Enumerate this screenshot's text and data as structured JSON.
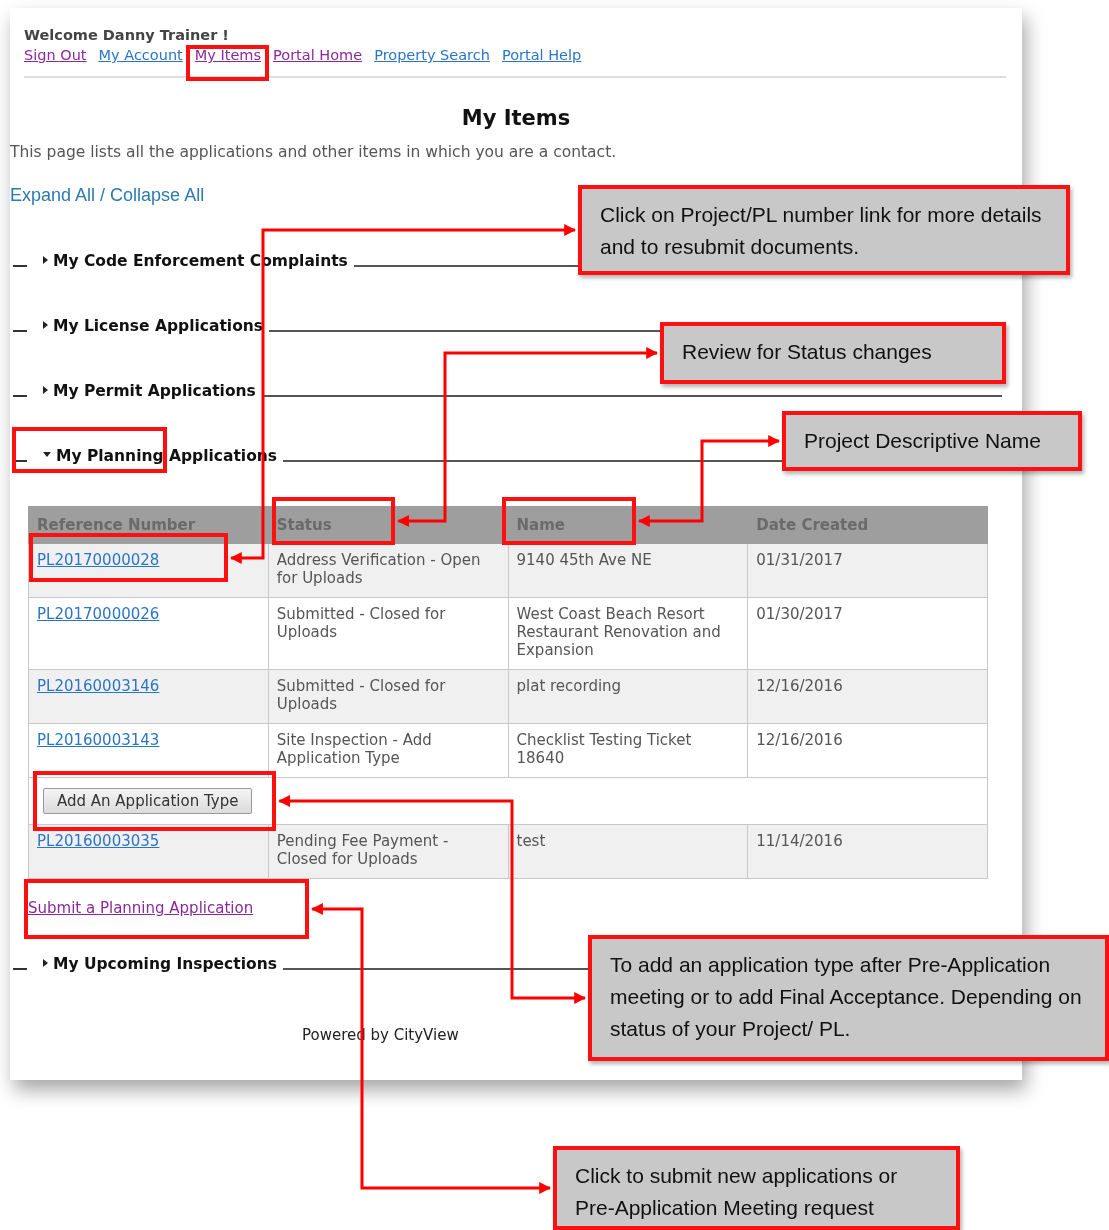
{
  "header": {
    "welcome": "Welcome Danny Trainer !",
    "links": [
      {
        "label": "Sign Out",
        "visited": true
      },
      {
        "label": "My Account",
        "visited": false
      },
      {
        "label": "My Items",
        "visited": true
      },
      {
        "label": "Portal Home",
        "visited": true
      },
      {
        "label": "Property Search",
        "visited": false
      },
      {
        "label": "Portal Help",
        "visited": false
      }
    ]
  },
  "title": "My Items",
  "description": "This page lists all the applications and other items in which you are a contact.",
  "toggle_links": {
    "expand": "Expand All",
    "separator": "/",
    "collapse": "Collapse All"
  },
  "sections": [
    {
      "title": "My Code Enforcement Complaints",
      "expanded": false
    },
    {
      "title": "My License Applications",
      "expanded": false
    },
    {
      "title": "My Permit Applications",
      "expanded": false
    },
    {
      "title": "My Planning Applications",
      "expanded": true,
      "table": {
        "columns": [
          "Reference Number",
          "Status",
          "Name",
          "Date Created"
        ],
        "rows": [
          {
            "kind": "record",
            "cells": [
              "PL20170000028",
              "Address Verification - Open for Uploads",
              "9140 45th Ave NE",
              "01/31/2017"
            ]
          },
          {
            "kind": "record",
            "cells": [
              "PL20170000026",
              "Submitted - Closed for Uploads",
              "West Coast Beach Resort Restaurant Renovation and Expansion",
              "01/30/2017"
            ]
          },
          {
            "kind": "record",
            "cells": [
              "PL20160003146",
              "Submitted - Closed for Uploads",
              "plat recording",
              "12/16/2016"
            ]
          },
          {
            "kind": "record",
            "cells": [
              "PL20160003143",
              "Site Inspection - Add Application Type",
              "Checklist Testing Ticket 18640",
              "12/16/2016"
            ]
          },
          {
            "kind": "action",
            "button": "Add An Application Type"
          },
          {
            "kind": "record",
            "cells": [
              "PL20160003035",
              "Pending Fee Payment - Closed for Uploads",
              "test",
              "11/14/2016"
            ]
          }
        ]
      },
      "submit_link": "Submit a Planning Application"
    },
    {
      "title": "My Upcoming Inspections",
      "expanded": false
    }
  ],
  "footer": "Powered by CityView",
  "callouts": [
    "Click on Project/PL number link for more details and to resubmit documents.",
    "Review for Status changes",
    "Project Descriptive Name",
    "To add an application type after Pre-Application meeting or to add Final Acceptance. Depending on status of your Project/ PL.",
    "Click to submit new applications or Pre-Application Meeting request"
  ]
}
